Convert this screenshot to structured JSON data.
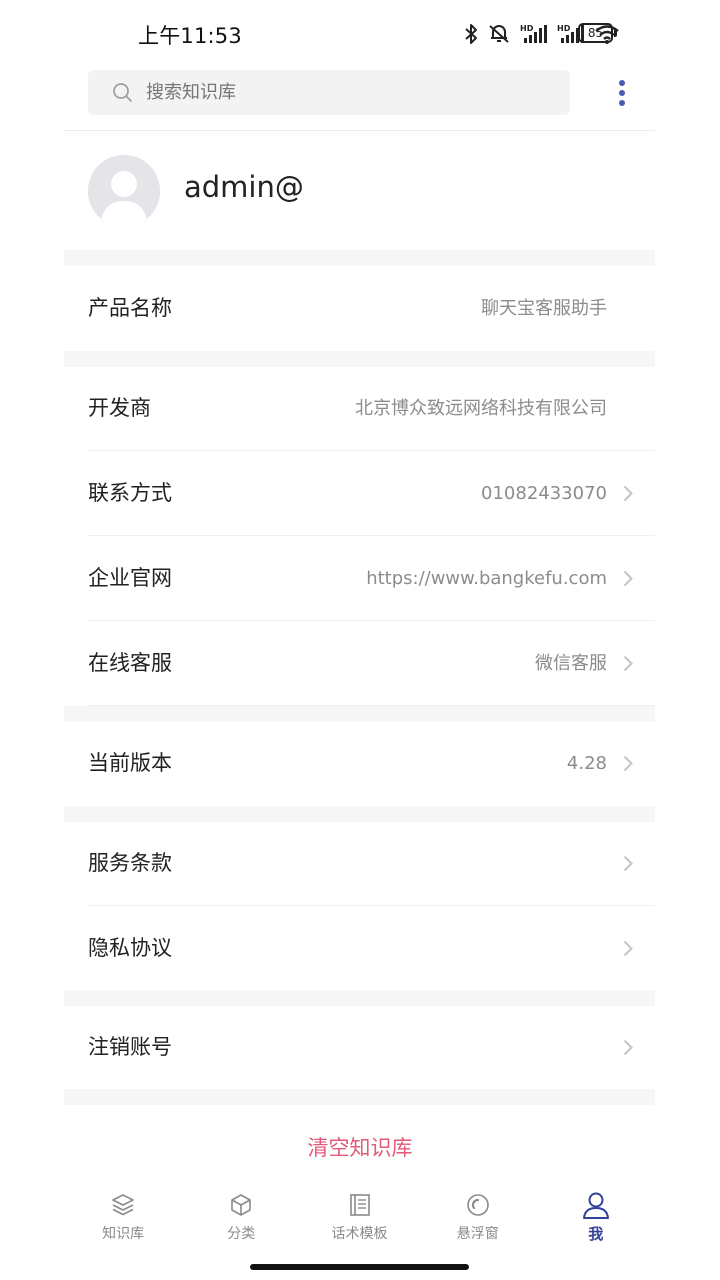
{
  "status_bar": {
    "time": "上午11:53",
    "battery": "85"
  },
  "search": {
    "placeholder": "搜索知识库",
    "value": ""
  },
  "profile": {
    "username": "admin@"
  },
  "rows": {
    "product_name": {
      "label": "产品名称",
      "value": "聊天宝客服助手"
    },
    "developer": {
      "label": "开发商",
      "value": "北京博众致远网络科技有限公司"
    },
    "contact": {
      "label": "联系方式",
      "value": "01082433070"
    },
    "website": {
      "label": "企业官网",
      "value": "https://www.bangkefu.com"
    },
    "online_service": {
      "label": "在线客服",
      "value": "微信客服"
    },
    "version": {
      "label": "当前版本",
      "value": "4.28"
    },
    "terms": {
      "label": "服务条款"
    },
    "privacy": {
      "label": "隐私协议"
    },
    "delete_account": {
      "label": "注销账号"
    }
  },
  "clear_button": {
    "label": "清空知识库"
  },
  "tabs": [
    {
      "label": "知识库",
      "icon": "layers-icon"
    },
    {
      "label": "分类",
      "icon": "cube-icon"
    },
    {
      "label": "话术模板",
      "icon": "document-icon"
    },
    {
      "label": "悬浮窗",
      "icon": "float-window-icon"
    },
    {
      "label": "我",
      "icon": "user-icon",
      "active": true
    }
  ],
  "colors": {
    "accent": "#34439a",
    "danger": "#e35a7a",
    "more": "#4a5bb3"
  }
}
